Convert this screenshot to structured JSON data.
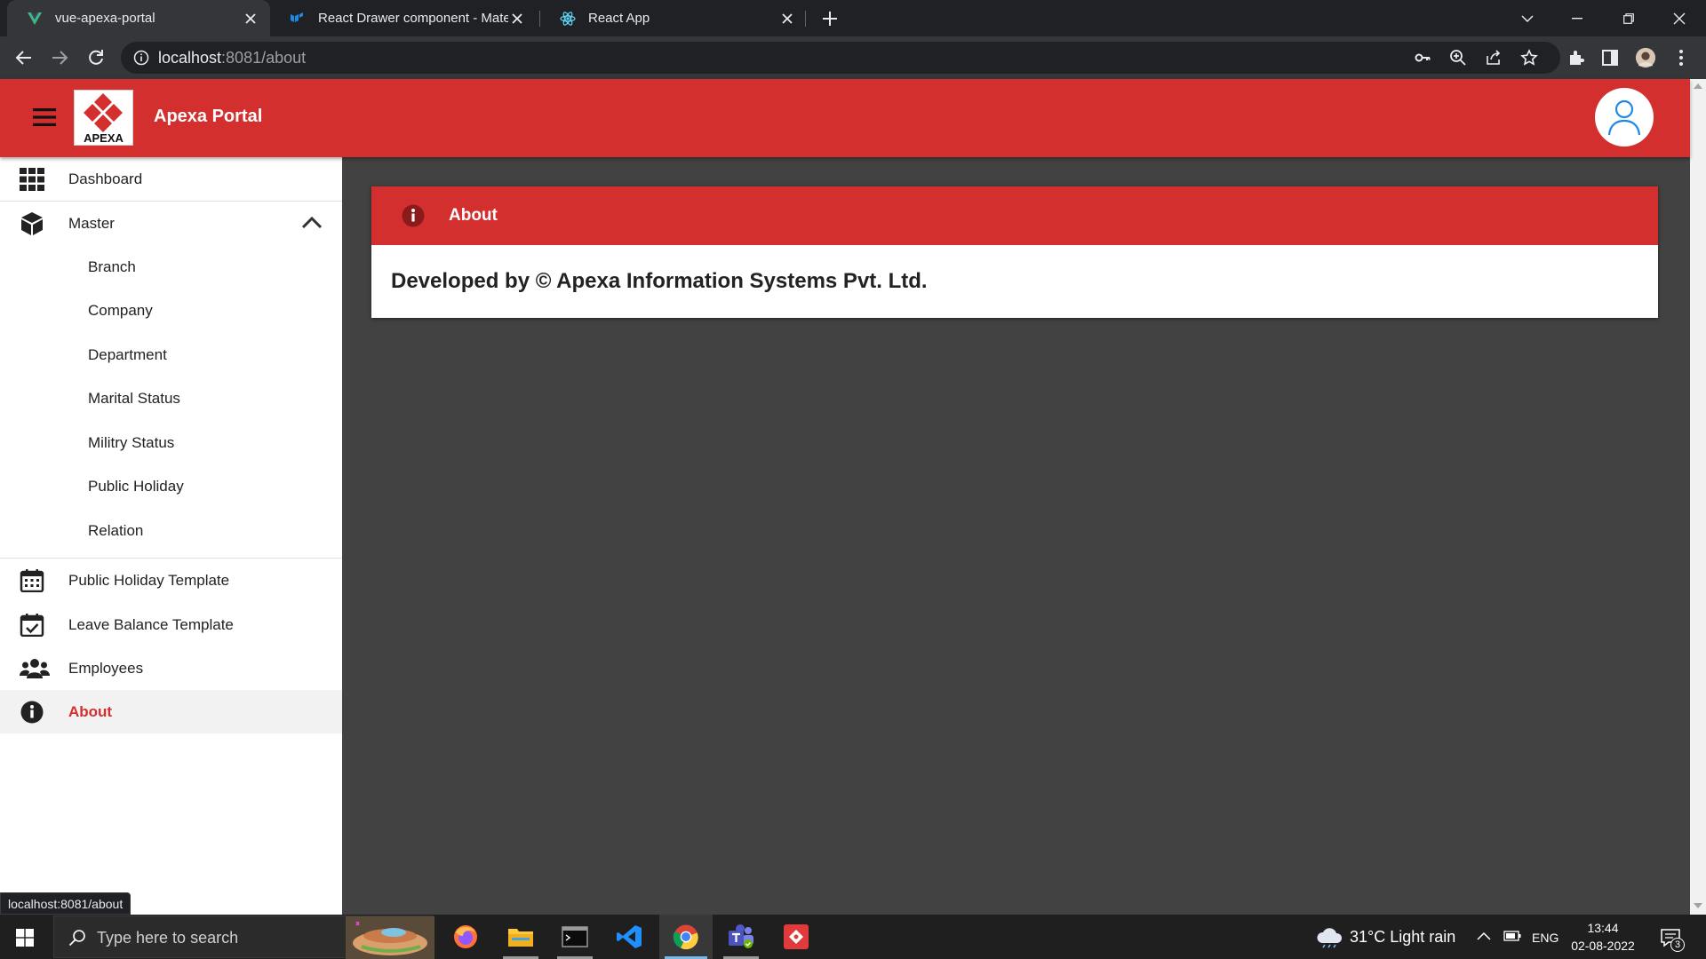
{
  "browser": {
    "tabs": [
      {
        "title": "vue-apexa-portal",
        "active": true
      },
      {
        "title": "React Drawer component - Mate",
        "active": false
      },
      {
        "title": "React App",
        "active": false
      }
    ],
    "url_host": "localhost",
    "url_rest": ":8081/about",
    "status_url": "localhost:8081/about"
  },
  "app": {
    "title": "Apexa Portal",
    "logo_text": "APEXA",
    "accent_color": "#d32f2f",
    "nav": [
      {
        "label": "Dashboard",
        "icon": "grid-icon"
      },
      {
        "label": "Master",
        "icon": "cube-icon",
        "expanded": true,
        "children": [
          "Branch",
          "Company",
          "Department",
          "Marital Status",
          "Militry Status",
          "Public Holiday",
          "Relation"
        ]
      },
      {
        "label": "Public Holiday Template",
        "icon": "calendar-icon"
      },
      {
        "label": "Leave Balance Template",
        "icon": "calendar-check-icon"
      },
      {
        "label": "Employees",
        "icon": "users-icon"
      },
      {
        "label": "About",
        "icon": "info-icon",
        "active": true
      }
    ],
    "page": {
      "header": "About",
      "body": "Developed by © Apexa Information Systems Pvt. Ltd."
    }
  },
  "taskbar": {
    "search_placeholder": "Type here to search",
    "weather": "31°C  Light rain",
    "language": "ENG",
    "time": "13:44",
    "date": "02-08-2022",
    "notifications": "3"
  }
}
